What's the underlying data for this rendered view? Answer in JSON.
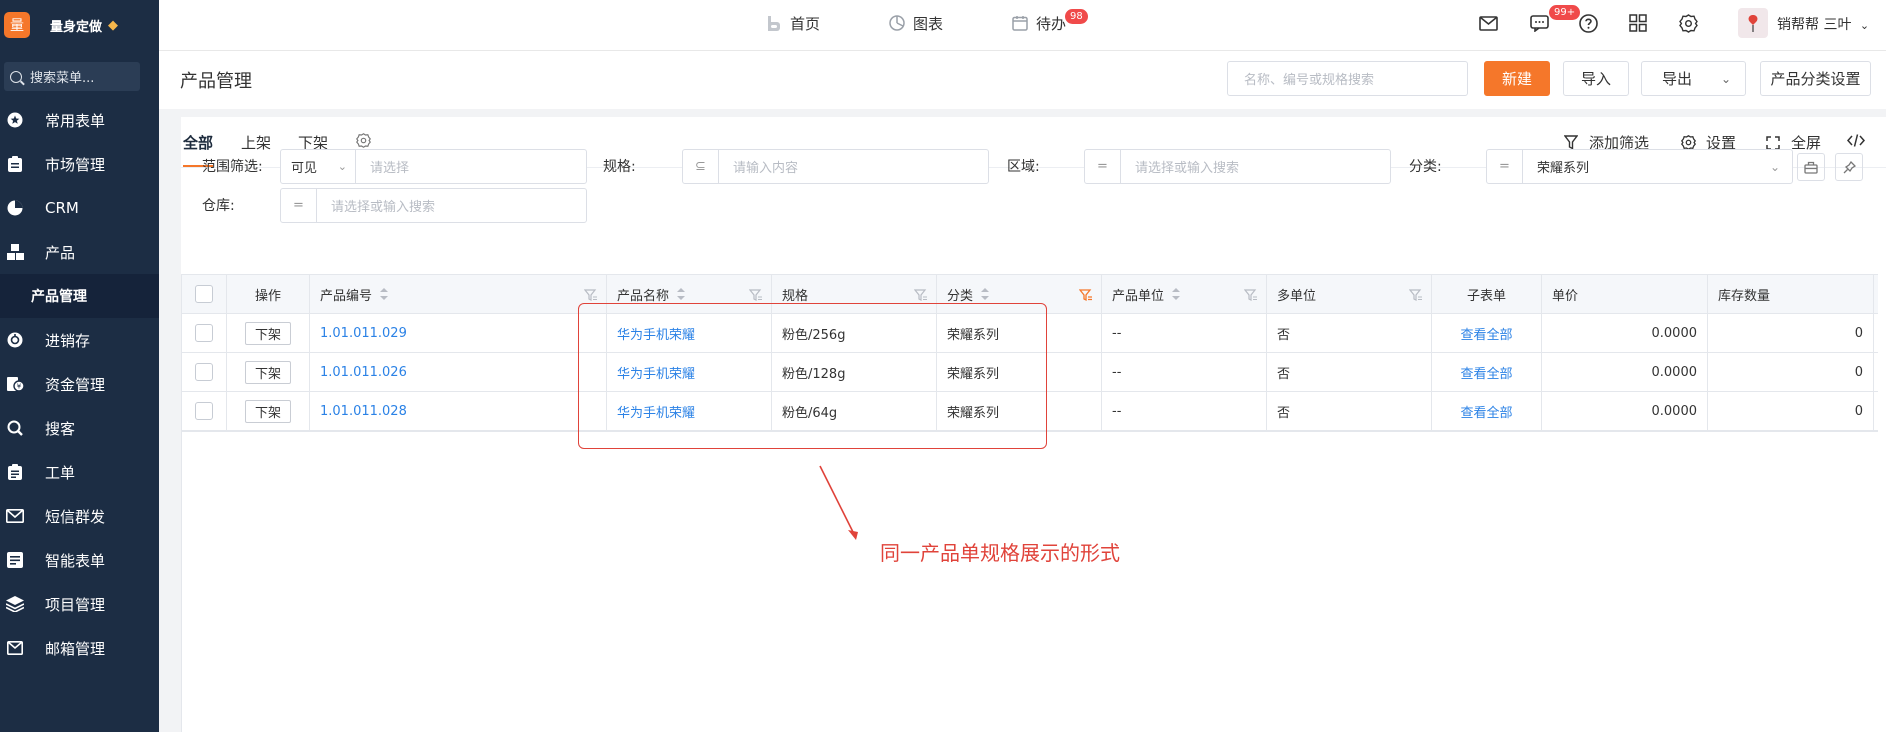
{
  "brand": {
    "logo_char": "量",
    "name": "量身定做"
  },
  "sidebar": {
    "search_placeholder": "搜索菜单...",
    "items": [
      {
        "label": "常用表单",
        "icon": "star-icon"
      },
      {
        "label": "市场管理",
        "icon": "clipboard-icon"
      },
      {
        "label": "CRM",
        "icon": "pie-icon"
      },
      {
        "label": "产品",
        "icon": "boxes-icon"
      },
      {
        "label": "产品管理",
        "sub": true
      },
      {
        "label": "进销存",
        "icon": "cycle-icon"
      },
      {
        "label": "资金管理",
        "icon": "money-icon"
      },
      {
        "label": "搜客",
        "icon": "search-icon"
      },
      {
        "label": "工单",
        "icon": "clipboard-list-icon"
      },
      {
        "label": "短信群发",
        "icon": "mail-icon"
      },
      {
        "label": "智能表单",
        "icon": "form-icon"
      },
      {
        "label": "项目管理",
        "icon": "layers-icon"
      },
      {
        "label": "邮箱管理",
        "icon": "envelope-icon"
      }
    ]
  },
  "topbar": {
    "nav": [
      {
        "label": "首页",
        "icon": "home-icon"
      },
      {
        "label": "图表",
        "icon": "chart-icon"
      },
      {
        "label": "待办",
        "icon": "calendar-icon",
        "badge": "98"
      }
    ],
    "message_badge": "99+",
    "user_name": "销帮帮 三叶"
  },
  "page_header": {
    "title": "产品管理",
    "search_placeholder": "名称、编号或规格搜索",
    "new_label": "新建",
    "import_label": "导入",
    "export_label": "导出",
    "category_settings_label": "产品分类设置"
  },
  "tabs": {
    "items": [
      "全部",
      "上架",
      "下架"
    ],
    "active": "全部",
    "tools": {
      "add_filter": "添加筛选",
      "settings": "设置",
      "fullscreen": "全屏"
    }
  },
  "filters": {
    "scope_label": "范围筛选:",
    "scope_value": "可见",
    "scope_placeholder": "请选择",
    "spec_label": "规格:",
    "spec_op": "⊆",
    "spec_placeholder": "请输入内容",
    "region_label": "区域:",
    "region_op": "=",
    "region_placeholder": "请选择或输入搜索",
    "category_label": "分类:",
    "category_op": "=",
    "category_value": "荣耀系列",
    "warehouse_label": "仓库:",
    "warehouse_op": "=",
    "warehouse_placeholder": "请选择或输入搜索"
  },
  "table": {
    "columns": [
      "操作",
      "产品编号",
      "产品名称",
      "规格",
      "分类",
      "产品单位",
      "多单位",
      "子表单",
      "单价",
      "库存数量"
    ],
    "rows": [
      {
        "action": "下架",
        "code": "1.01.011.029",
        "name": "华为手机荣耀",
        "spec": "粉色/256g",
        "category": "荣耀系列",
        "unit": "--",
        "multi_unit": "否",
        "subform": "查看全部",
        "price": "0.0000",
        "stock": "0"
      },
      {
        "action": "下架",
        "code": "1.01.011.026",
        "name": "华为手机荣耀",
        "spec": "粉色/128g",
        "category": "荣耀系列",
        "unit": "--",
        "multi_unit": "否",
        "subform": "查看全部",
        "price": "0.0000",
        "stock": "0"
      },
      {
        "action": "下架",
        "code": "1.01.011.028",
        "name": "华为手机荣耀",
        "spec": "粉色/64g",
        "category": "荣耀系列",
        "unit": "--",
        "multi_unit": "否",
        "subform": "查看全部",
        "price": "0.0000",
        "stock": "0"
      }
    ]
  },
  "annotation": {
    "text": "同一产品单规格展示的形式",
    "color": "#e0433a"
  },
  "colors": {
    "accent": "#f5772a",
    "sidebar_bg": "#1c2d44",
    "link": "#2b82e6"
  }
}
